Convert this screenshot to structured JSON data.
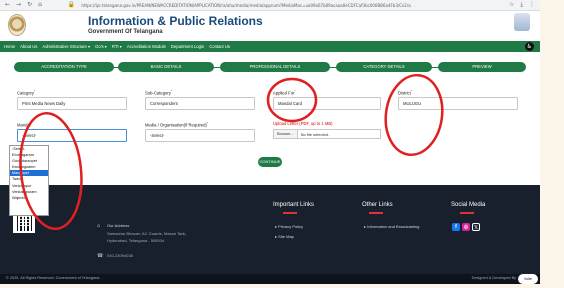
{
  "browser": {
    "nav_icons": [
      "←",
      "→",
      "↻",
      "⌂"
    ],
    "lock_icon": "🔒",
    "url": "https://ipr.telangana.gov.in/PREAN/NEWACCREDITATION/APPLICATION/ra/ahu/media/media/appnum?MediaMac=ua09a67b09acaaa0eCDFCaf3bc000BB6a4Fb3/Cs2ra0CbU9C0",
    "right_icons": [
      "☆",
      "⤓",
      "⋮"
    ]
  },
  "header": {
    "title": "Information & Public Relations",
    "subtitle": "Government Of Telangana"
  },
  "nav": {
    "items": [
      "Home",
      "About Us",
      "Administrative Structure ▾",
      "Go's ▾",
      "RTI ▾",
      "Accreditation Module",
      "Department Login",
      "Contact Us"
    ],
    "accessibility_icon": "♿"
  },
  "tabs": [
    "ACCREDITATION TYPE",
    "BASIC DETAILS",
    "PROFESSIONAL DETAILS",
    "CATEGORY DETAILS",
    "PREVIEW"
  ],
  "form": {
    "category_label": "Category",
    "category_value": "Print Media News Daily",
    "subcategory_label": "Sub-Category",
    "subcategory_value": "Correspondent",
    "applied_for_label": "Applied For",
    "applied_for_value": "Mandal Card",
    "district_label": "District",
    "district_value": "MULUGU",
    "mandal_label": "Mandal",
    "mandal_value": "-Select-",
    "media_org_label": "Media / Organisation(If Required)",
    "media_org_value": "-Select-",
    "upload_label": "Upload Letter (PDF, up to 1 MB)",
    "upload_button": "Browse...",
    "upload_status": "No file selected.",
    "continue_label": "CONTINUE"
  },
  "mandal_options": [
    {
      "label": "-Select-",
      "selected": false
    },
    {
      "label": "Eturnagaram",
      "selected": false
    },
    {
      "label": "Govindaraopet",
      "selected": false
    },
    {
      "label": "Kannaigudem",
      "selected": false
    },
    {
      "label": "Mangapet",
      "selected": true
    },
    {
      "label": "Tadvai",
      "selected": false
    },
    {
      "label": "Venkatapur",
      "selected": false
    },
    {
      "label": "Venkatapuram",
      "selected": false
    },
    {
      "label": "Wajedu",
      "selected": false
    }
  ],
  "footer": {
    "address_title": "Our Address",
    "address_lines": [
      "Samachar Bhavan, AC Guards, Masab Tank,",
      "Hyderabad, Telangana - 500004"
    ],
    "phone": "040-23094038",
    "important_links_title": "Important Links",
    "important_links": [
      "Privacy Policy",
      "Site Map"
    ],
    "other_links_title": "Other Links",
    "other_links": [
      "Information and Broadcasting"
    ],
    "social_title": "Social Media",
    "social": [
      {
        "name": "facebook-icon",
        "glyph": "f",
        "color": "#1877f2"
      },
      {
        "name": "instagram-icon",
        "glyph": "◎",
        "color": "#d6249f"
      },
      {
        "name": "x-icon",
        "glyph": "𝕏",
        "color": "#111111"
      }
    ],
    "copyright": "© 2025. All Rights Reserved. Government of Telangana.",
    "designed_by": "Designed & Developed By",
    "chat_badge": "Volte"
  },
  "colors": {
    "primary_green": "#1f7a45",
    "title_blue": "#1a4a7a",
    "footer_bg": "#17202c",
    "annotation_red": "#e02020",
    "selected_option": "#1e6fd6"
  }
}
